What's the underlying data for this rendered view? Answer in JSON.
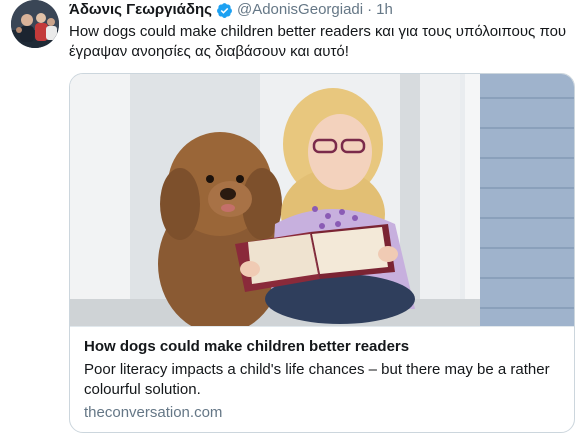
{
  "tweet": {
    "display_name": "Άδωνις Γεωργιάδης",
    "verified_icon": "verified-badge-icon",
    "handle": "@AdonisGeorgiadi",
    "separator": "·",
    "time": "1h",
    "text_line1": "How dogs could make children better readers και για τους υπόλοιπους που",
    "text_line2": "έγραψαν ανοησίες ας διαβάσουν και αυτό!"
  },
  "card": {
    "image_description_icon": "photo-girl-reading-with-dog",
    "title": "How dogs could make children better readers",
    "description_line1": "Poor literacy impacts a child's life chances – but there may be a rather",
    "description_line2": "colourful solution.",
    "domain": "theconversation.com"
  },
  "colors": {
    "text_primary": "#14171a",
    "text_secondary": "#657786",
    "verified_blue": "#1da1f2",
    "card_border": "#ccd6dd"
  }
}
